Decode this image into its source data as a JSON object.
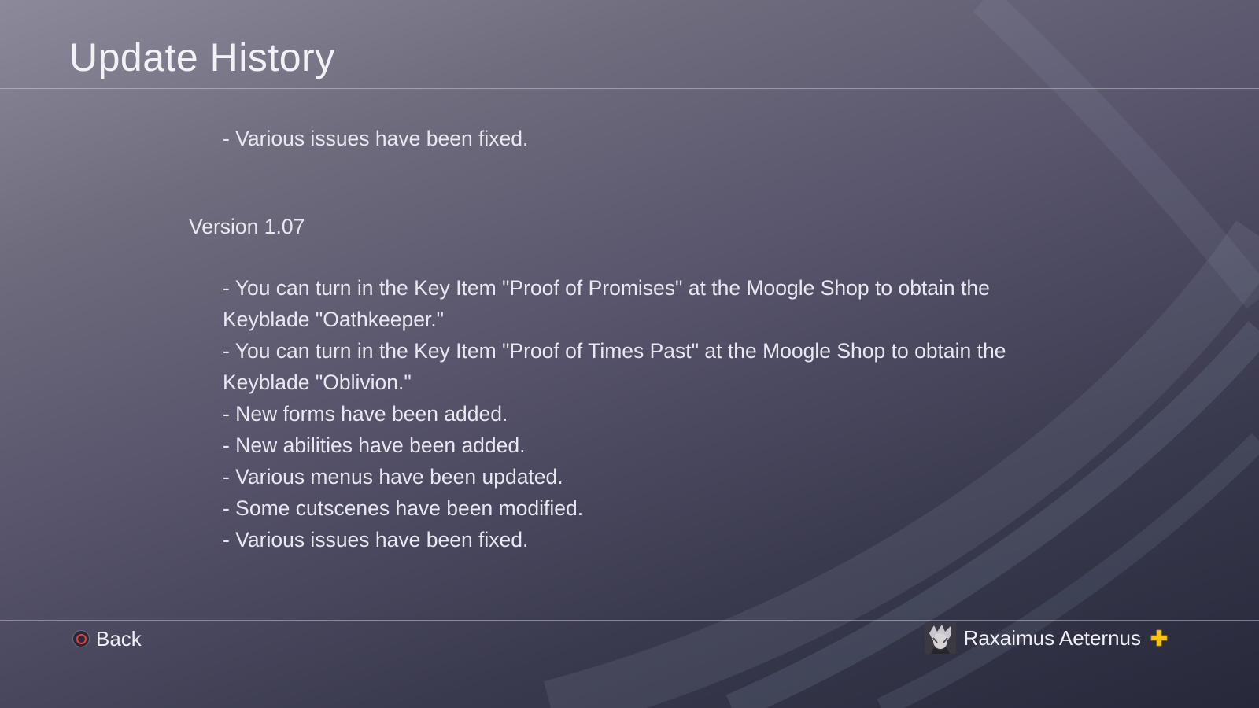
{
  "header": {
    "title": "Update History"
  },
  "content": {
    "lines": [
      " - Various issues have been fixed.",
      "Version 1.07",
      " - You can turn in the Key Item \"Proof of Promises\" at the Moogle Shop to obtain the",
      "Keyblade \"Oathkeeper.\"",
      " - You can turn in the Key Item \"Proof of Times Past\" at the Moogle Shop to obtain the",
      "Keyblade \"Oblivion.\"",
      " - New forms have been added.",
      " - New abilities have been added.",
      " - Various menus have been updated.",
      " - Some cutscenes have been modified.",
      " - Various issues have been fixed."
    ]
  },
  "footer": {
    "back_label": "Back",
    "back_icon": "circle-button-icon",
    "user_name": "Raxaimus Aeternus",
    "plus_icon": "playstation-plus-icon"
  },
  "colors": {
    "circle_button": "#e0404a",
    "plus_badge": "#f5c518"
  }
}
